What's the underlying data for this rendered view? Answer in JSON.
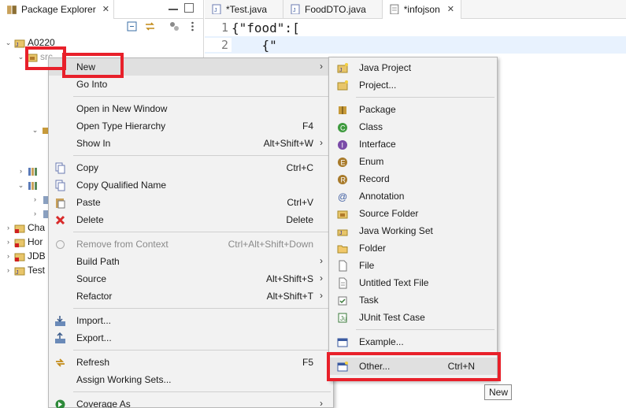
{
  "package_explorer": {
    "tab_label": "Package Explorer",
    "close_glyph": "✕",
    "tree": [
      {
        "label": "A0220",
        "twisty": "⌄",
        "indent": 0,
        "icon": "java-project-icon"
      },
      {
        "label": "src",
        "twisty": "⌄",
        "indent": 1,
        "icon": "source-folder-icon"
      },
      {
        "label": "Cha",
        "twisty": "›",
        "indent": 0,
        "icon": "java-project-error-icon"
      },
      {
        "label": "Hor",
        "twisty": "›",
        "indent": 0,
        "icon": "java-project-error-icon"
      },
      {
        "label": "JDB",
        "twisty": "›",
        "indent": 0,
        "icon": "java-project-error-icon"
      },
      {
        "label": "Test",
        "twisty": "›",
        "indent": 0,
        "icon": "java-project-icon"
      }
    ]
  },
  "editor": {
    "tabs": [
      {
        "label": "*Test.java",
        "icon": "java-file-icon",
        "active": false
      },
      {
        "label": "FoodDTO.java",
        "icon": "java-file-icon",
        "active": false
      },
      {
        "label": "*infojson",
        "icon": "text-file-icon",
        "active": true,
        "close": "✕"
      }
    ],
    "lines": [
      {
        "num": "1",
        "text": "{\"food\":["
      },
      {
        "num": "2",
        "text": "    {\""
      }
    ]
  },
  "context_menu": {
    "items": [
      {
        "label": "New",
        "shortcut": "",
        "submenu": true,
        "icon": "",
        "highlighted": true
      },
      {
        "label": "Go Into",
        "shortcut": "",
        "icon": ""
      },
      {
        "sep": true
      },
      {
        "label": "Open in New Window",
        "shortcut": "",
        "icon": ""
      },
      {
        "label": "Open Type Hierarchy",
        "shortcut": "F4",
        "icon": ""
      },
      {
        "label": "Show In",
        "shortcut": "Alt+Shift+W",
        "submenu": true,
        "icon": ""
      },
      {
        "sep": true
      },
      {
        "label": "Copy",
        "shortcut": "Ctrl+C",
        "icon": "copy-icon"
      },
      {
        "label": "Copy Qualified Name",
        "shortcut": "",
        "icon": "copy-qualified-icon"
      },
      {
        "label": "Paste",
        "shortcut": "Ctrl+V",
        "icon": "paste-icon"
      },
      {
        "label": "Delete",
        "shortcut": "Delete",
        "icon": "delete-icon"
      },
      {
        "sep": true
      },
      {
        "label": "Remove from Context",
        "shortcut": "Ctrl+Alt+Shift+Down",
        "icon": "remove-context-icon",
        "disabled": true
      },
      {
        "label": "Build Path",
        "shortcut": "",
        "submenu": true,
        "icon": ""
      },
      {
        "label": "Source",
        "shortcut": "Alt+Shift+S",
        "submenu": true,
        "icon": ""
      },
      {
        "label": "Refactor",
        "shortcut": "Alt+Shift+T",
        "submenu": true,
        "icon": ""
      },
      {
        "sep": true
      },
      {
        "label": "Import...",
        "shortcut": "",
        "icon": "import-icon"
      },
      {
        "label": "Export...",
        "shortcut": "",
        "icon": "export-icon"
      },
      {
        "sep": true
      },
      {
        "label": "Refresh",
        "shortcut": "F5",
        "icon": "refresh-icon"
      },
      {
        "label": "Assign Working Sets...",
        "shortcut": "",
        "icon": ""
      },
      {
        "sep": true
      },
      {
        "label": "Coverage As",
        "shortcut": "",
        "submenu": true,
        "icon": "coverage-icon"
      }
    ]
  },
  "new_submenu": {
    "items": [
      {
        "label": "Java Project",
        "shortcut": "",
        "icon": "java-project-icon"
      },
      {
        "label": "Project...",
        "shortcut": "",
        "icon": "project-icon"
      },
      {
        "sep": true
      },
      {
        "label": "Package",
        "shortcut": "",
        "icon": "package-icon"
      },
      {
        "label": "Class",
        "shortcut": "",
        "icon": "class-icon"
      },
      {
        "label": "Interface",
        "shortcut": "",
        "icon": "interface-icon"
      },
      {
        "label": "Enum",
        "shortcut": "",
        "icon": "enum-icon"
      },
      {
        "label": "Record",
        "shortcut": "",
        "icon": "record-icon"
      },
      {
        "label": "Annotation",
        "shortcut": "",
        "icon": "annotation-icon"
      },
      {
        "label": "Source Folder",
        "shortcut": "",
        "icon": "source-folder-icon"
      },
      {
        "label": "Java Working Set",
        "shortcut": "",
        "icon": "working-set-icon"
      },
      {
        "label": "Folder",
        "shortcut": "",
        "icon": "folder-icon"
      },
      {
        "label": "File",
        "shortcut": "",
        "icon": "file-icon"
      },
      {
        "label": "Untitled Text File",
        "shortcut": "",
        "icon": "text-file-icon"
      },
      {
        "label": "Task",
        "shortcut": "",
        "icon": "task-icon"
      },
      {
        "label": "JUnit Test Case",
        "shortcut": "",
        "icon": "junit-icon"
      },
      {
        "sep": true
      },
      {
        "label": "Example...",
        "shortcut": "",
        "icon": "example-icon"
      },
      {
        "sep": true
      },
      {
        "label": "Other...",
        "shortcut": "Ctrl+N",
        "icon": "other-wizard-icon",
        "highlighted": true
      }
    ]
  },
  "tooltip": {
    "text": "New"
  },
  "colors": {
    "highlight_box": "#e8202a",
    "menu_bg": "#f2f2f2",
    "editor_current_line": "#e8f2fe"
  }
}
